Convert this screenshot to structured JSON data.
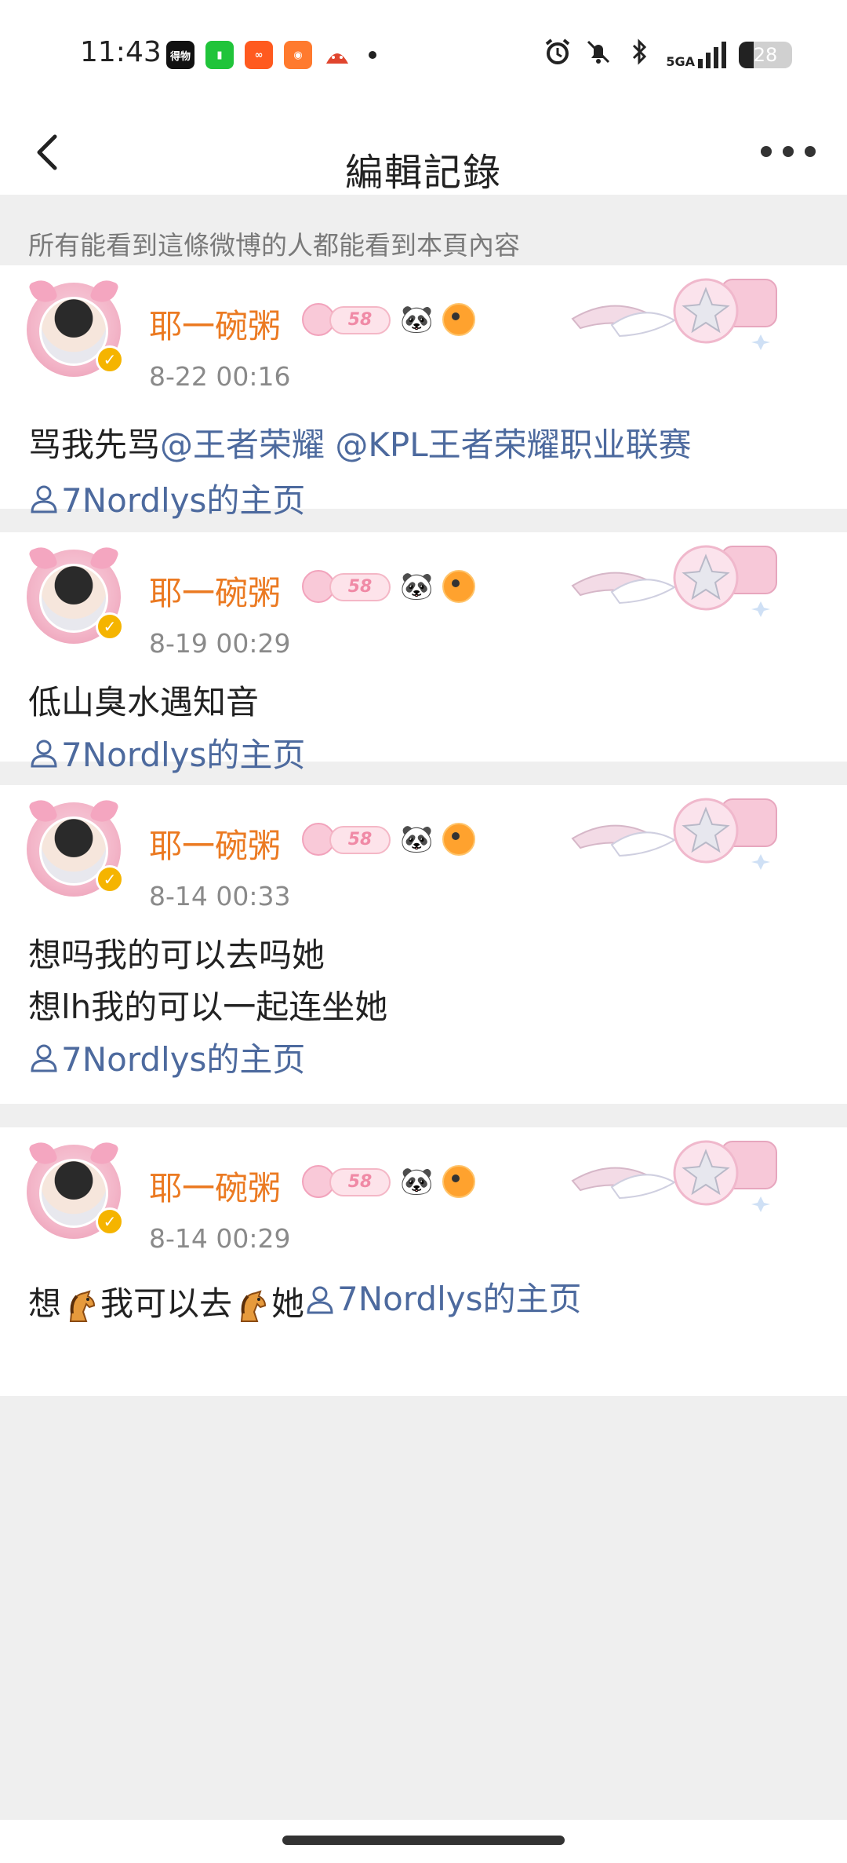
{
  "status_bar": {
    "time": "11:43",
    "apps": [
      {
        "icon": "dewu-app-icon",
        "label": "得物",
        "color": "#111111"
      },
      {
        "icon": "iqiyi-app-icon",
        "label": "",
        "color": "#20c43a"
      },
      {
        "icon": "xiaohongshu-app-icon",
        "label": "",
        "color": "#ff5a1f"
      },
      {
        "icon": "fan-app-icon",
        "label": "",
        "color": "#ff7a2e"
      },
      {
        "icon": "game-app-icon",
        "label": "",
        "color": "#e0452e"
      }
    ],
    "network": "5GA",
    "battery": "28",
    "battery_level": 0.28
  },
  "header": {
    "title": "編輯記錄"
  },
  "notice": "所有能看到這條微博的人都能看到本頁內容",
  "posts": [
    {
      "username": "耶一碗粥",
      "level": "58",
      "time": "8-22 00:16",
      "lines": [
        [
          {
            "t": "骂我先骂",
            "link": false
          },
          {
            "t": "@王者荣耀 @KPL王者荣耀职业联赛",
            "link": true
          }
        ]
      ],
      "home": "7Nordlys的主页"
    },
    {
      "username": "耶一碗粥",
      "level": "58",
      "time": "8-19 00:29",
      "lines": [
        [
          {
            "t": "低山臭水遇知音",
            "link": false
          }
        ]
      ],
      "home": "7Nordlys的主页"
    },
    {
      "username": "耶一碗粥",
      "level": "58",
      "time": "8-14 00:33",
      "lines": [
        [
          {
            "t": "想吗我的可以去吗她",
            "link": false
          }
        ],
        [
          {
            "t": "想lh我的可以一起连坐她",
            "link": false
          }
        ]
      ],
      "home": "7Nordlys的主页"
    },
    {
      "username": "耶一碗粥",
      "level": "58",
      "time": "8-14 00:29",
      "inline": {
        "part1": "想",
        "part2": "我可以去",
        "part3": "她",
        "home": "7Nordlys的主页"
      }
    }
  ],
  "colors": {
    "username": "#eb7a22",
    "link": "#4d6a9e",
    "meta": "#8a8a8a"
  }
}
